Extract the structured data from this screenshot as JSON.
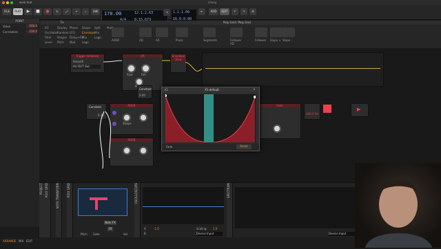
{
  "window": {
    "title": "walk-feat",
    "center_logo": "bitwig"
  },
  "toolbar": {
    "file": "FILE",
    "play": "PLAY",
    "lnk": "LNK",
    "add": "ADD",
    "edit": "EDIT"
  },
  "transport": {
    "tempo": "170.00",
    "sig": "4/4",
    "pos_a": "12.1.2.63",
    "pos_b": "0:15.673",
    "arr_a": "1.1.1.00",
    "arr_b": "16.0.0.00"
  },
  "left": {
    "header": "POINT",
    "rows": [
      {
        "label": "Value",
        "value": "600.0"
      },
      {
        "label": "Correlation",
        "value": "100.0"
      }
    ]
  },
  "browser": {
    "tabs": [
      "Tie",
      "Poly Grid / Poly Grid"
    ],
    "categories": [
      [
        "I/O",
        "Display",
        "Phase",
        "Shape",
        "Split",
        "Math"
      ],
      [
        "Oscillator",
        "Random",
        "LFO",
        "Envelope",
        "Mix"
      ],
      [
        "Filter",
        "Shaper",
        "Delay+FX",
        "Mix",
        "Logic"
      ],
      [
        "Level",
        "Pitch",
        "Mod",
        "Logic"
      ]
    ],
    "selected": "Envelope",
    "devices": [
      "ADSR",
      "AD",
      "AR",
      "Pluck",
      "Segments",
      "Follower AD",
      "Follower",
      "Slope +",
      "Slope -"
    ]
  },
  "patch": {
    "title": "Poly Grid / Poly Grid",
    "modules": {
      "trigger_in": "Trigger Initializer",
      "trigger_sub": "Smooth",
      "gate_dest": "AU OUT Out",
      "mixer": "Mixer",
      "ar": "AR",
      "adsr": "ADSR",
      "env_view": "Envelope View",
      "constant": "Constant",
      "constant2": "Constant",
      "val_const": "0.00",
      "val_const2": "0.35",
      "gain": "Gain",
      "rise": "Rise",
      "fall": "Fall",
      "hold": "Hold",
      "shape": "Shape",
      "hz": "440.0 Hz"
    }
  },
  "popup": {
    "title": "K1",
    "preset": "X1-default",
    "mode": "Fade",
    "button": "Reset",
    "stripes": 6
  },
  "bottom": {
    "tabs": [
      "PROJECT",
      "POLY GRID",
      "NOTE TRANSFORM",
      "POLY GRID",
      "OSCILLOSCOPE",
      "SPECTRUM"
    ],
    "note_fx": "Note FX",
    "fx": "FX",
    "pitch": "Pitch",
    "gate": "Gate",
    "velocity": "Vel",
    "scaling": "Scaling",
    "device_input": "Device Input",
    "device_input2": "Device Input",
    "scale_a": "-1.0",
    "scale_b": "1.0",
    "a_val": "A",
    "b_val": "B"
  },
  "status": {
    "arrange": "ARRANGE",
    "mix": "MIX",
    "edit": "EDIT"
  },
  "colors": {
    "accent": "#e9424f",
    "orange": "#f18f2f",
    "teal": "#38a39a",
    "blue": "#3c7fd9"
  }
}
